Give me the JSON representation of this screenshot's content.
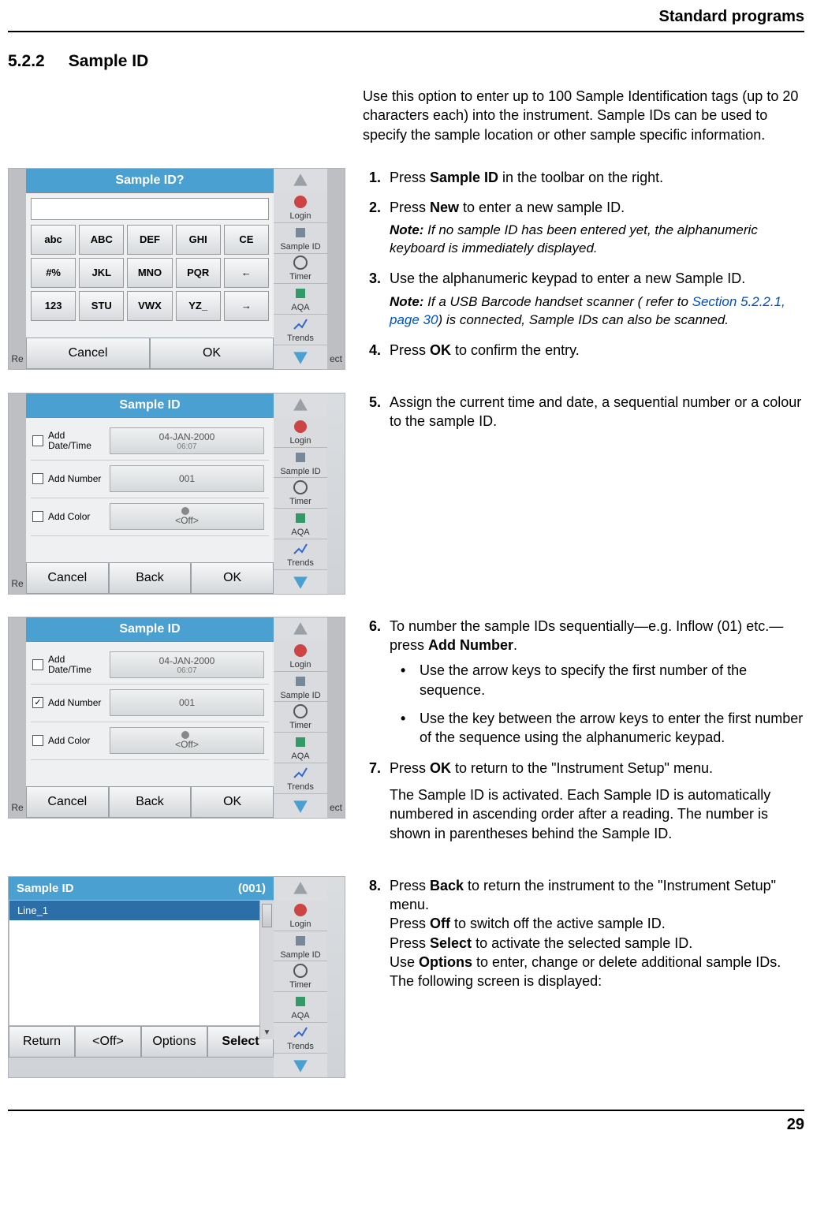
{
  "header": {
    "chapter": "Standard programs"
  },
  "section": {
    "number": "5.2.2",
    "title": "Sample ID"
  },
  "intro": "Use this option to enter up to 100 Sample Identification tags (up to 20 characters each) into the instrument. Sample IDs can be used to specify  the sample location or other sample specific information.",
  "steps": {
    "s1": {
      "pre": "Press ",
      "bold": "Sample ID",
      "post": " in the toolbar on the right."
    },
    "s2": {
      "pre": "Press ",
      "bold": "New",
      "post": " to enter a new sample ID."
    },
    "note1": {
      "label": "Note:",
      "text": " If no sample ID has been entered yet, the alphanumeric keyboard is immediately displayed."
    },
    "s3": {
      "text": "Use the alphanumeric keypad to enter a new Sample ID."
    },
    "note2": {
      "label": "Note:",
      "pre": " If a USB Barcode handset scanner ( refer to ",
      "link": "Section 5.2.2.1, page 30",
      "post": ") is connected, Sample IDs can also be scanned."
    },
    "s4": {
      "pre": "Press ",
      "bold": "OK",
      "post": " to confirm the entry."
    },
    "s5": {
      "text": "Assign the current time and date, a sequential number or a colour to the sample ID."
    },
    "s6": {
      "pre": "To number the sample IDs sequentially—e.g. Inflow (01) etc.—press ",
      "bold": "Add Number",
      "post": "."
    },
    "s6b1": "Use the arrow keys to specify the first number of the sequence.",
    "s6b2": "Use the key between the arrow keys to enter the first number of the sequence using the alphanumeric keypad.",
    "s7": {
      "pre": "Press ",
      "bold": "OK",
      "post": " to return to the \"Instrument Setup\" menu."
    },
    "s7p": "The Sample ID is activated. Each Sample ID is automatically numbered in ascending order after a reading. The number is shown in parentheses behind the Sample ID.",
    "s8a": {
      "pre": "Press ",
      "bold": "Back",
      "post": " to return the instrument to the \"Instrument Setup\" menu."
    },
    "s8b": {
      "pre": "Press ",
      "bold": "Off",
      "post": " to switch off the active sample ID."
    },
    "s8c": {
      "pre": "Press ",
      "bold": "Select",
      "post": " to activate the selected sample ID."
    },
    "s8d": {
      "pre": "Use ",
      "bold": "Options",
      "post": " to enter, change or delete additional sample IDs. The following screen is displayed:"
    }
  },
  "sidebar": {
    "login": "Login",
    "sampleid": "Sample ID",
    "timer": "Timer",
    "aqa": "AQA",
    "trends": "Trends"
  },
  "shot1": {
    "title": "Sample ID?",
    "edge_left": "Re",
    "edge_right": "ect",
    "keys": [
      "abc",
      "ABC",
      "DEF",
      "GHI",
      "CE",
      "#%",
      "JKL",
      "MNO",
      "PQR",
      "←",
      "123",
      "STU",
      "VWX",
      "YZ_",
      "→"
    ],
    "cancel": "Cancel",
    "ok": "OK"
  },
  "shot2": {
    "title": "Sample ID",
    "edge_left": "Re",
    "rows": [
      {
        "label": "Add Date/Time",
        "val": "04-JAN-2000",
        "sub": "06:07",
        "checked": false
      },
      {
        "label": "Add Number",
        "val": "001",
        "sub": "",
        "checked": false
      },
      {
        "label": "Add Color",
        "val": "<Off>",
        "sub": "",
        "checked": false,
        "dot": true
      }
    ],
    "cancel": "Cancel",
    "back": "Back",
    "ok": "OK"
  },
  "shot3": {
    "title": "Sample ID",
    "edge_left": "Re",
    "edge_right": "ect",
    "rows": [
      {
        "label": "Add Date/Time",
        "val": "04-JAN-2000",
        "sub": "06:07",
        "checked": false
      },
      {
        "label": "Add Number",
        "val": "001",
        "sub": "",
        "checked": true
      },
      {
        "label": "Add Color",
        "val": "<Off>",
        "sub": "",
        "checked": false,
        "dot": true
      }
    ],
    "cancel": "Cancel",
    "back": "Back",
    "ok": "OK"
  },
  "shot4": {
    "head_left": "Sample ID",
    "head_right": "(001)",
    "row_left": "Line_1",
    "row_right": "",
    "row2": "",
    "return": "Return",
    "off": "<Off>",
    "options": "Options",
    "select": "Select"
  },
  "page_number": "29"
}
